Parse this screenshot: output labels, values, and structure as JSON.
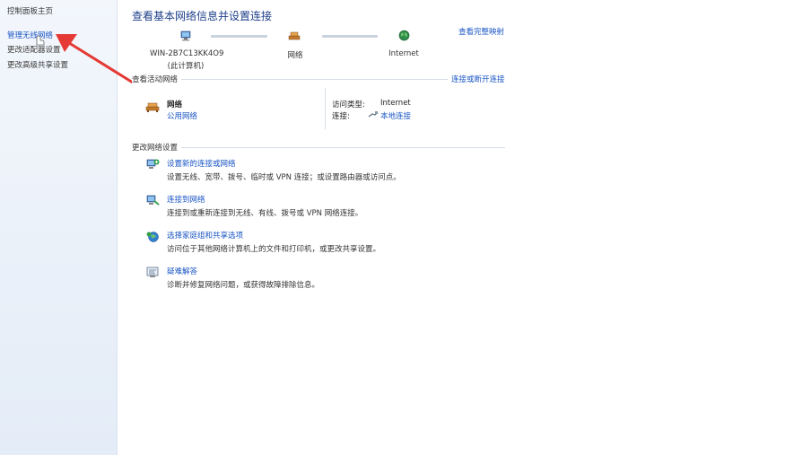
{
  "sidebar": {
    "home": "控制面板主页",
    "items": [
      {
        "label": "管理无线网络"
      },
      {
        "label": "更改适配器设置"
      },
      {
        "label": "更改高级共享设置"
      }
    ]
  },
  "main": {
    "title": "查看基本网络信息并设置连接",
    "full_map_link": "查看完整映射",
    "network_map": {
      "computer_name": "WIN-2B7C13KK4O9",
      "computer_note": "(此计算机)",
      "network": "网络",
      "internet": "Internet"
    },
    "active_networks": {
      "header": "查看活动网络",
      "connect_link": "连接或断开连接",
      "network_name": "网络",
      "network_type": "公用网络",
      "access_type_label": "访问类型:",
      "access_type_value": "Internet",
      "connection_label": "连接:",
      "connection_value": "本地连接"
    },
    "change_settings": {
      "header": "更改网络设置",
      "tasks": [
        {
          "title": "设置新的连接或网络",
          "desc": "设置无线、宽带、拨号、临时或 VPN 连接；或设置路由器或访问点。"
        },
        {
          "title": "连接到网络",
          "desc": "连接到或重新连接到无线、有线、拨号或 VPN 网络连接。"
        },
        {
          "title": "选择家庭组和共享选项",
          "desc": "访问位于其他网络计算机上的文件和打印机，或更改共享设置。"
        },
        {
          "title": "疑难解答",
          "desc": "诊断并修复网络问题，或获得故障排除信息。"
        }
      ]
    }
  },
  "colors": {
    "link": "#1a55c4",
    "annotation_arrow": "#e53935"
  }
}
